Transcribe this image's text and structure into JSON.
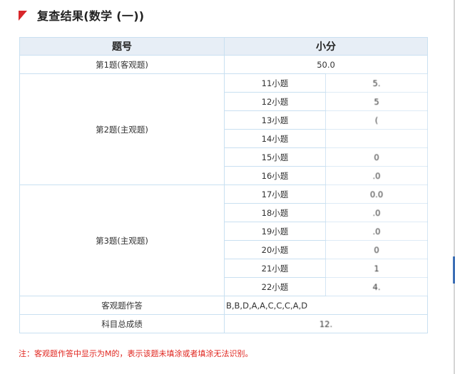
{
  "page": {
    "title": "复查结果(数学 (一))",
    "note": "注：客观题作答中显示为M的，表示该题未填涂或者填涂无法识别。"
  },
  "table": {
    "headers": [
      "题号",
      "小分"
    ],
    "q1": {
      "label": "第1题(客观题)",
      "value": "50.0"
    },
    "q2": {
      "label": "第2题(主观题)",
      "items": [
        {
          "sub": "11小题",
          "score": "5."
        },
        {
          "sub": "12小题",
          "score": "5"
        },
        {
          "sub": "13小题",
          "score": "("
        },
        {
          "sub": "14小题",
          "score": ""
        },
        {
          "sub": "15小题",
          "score": "0"
        },
        {
          "sub": "16小题",
          "score": ".0"
        }
      ]
    },
    "q3": {
      "label": "第3题(主观题)",
      "items": [
        {
          "sub": "17小题",
          "score": "0.0"
        },
        {
          "sub": "18小题",
          "score": ".0"
        },
        {
          "sub": "19小题",
          "score": ".0"
        },
        {
          "sub": "20小题",
          "score": "0"
        },
        {
          "sub": "21小题",
          "score": "1"
        },
        {
          "sub": "22小题",
          "score": "4."
        }
      ]
    },
    "objective_answer": {
      "label": "客观题作答",
      "value": "B,B,D,A,A,C,C,C,A,D"
    },
    "total": {
      "label": "科目总成绩",
      "value": "12."
    }
  },
  "colors": {
    "accent": "#d8262a",
    "header_bg": "#e7eef6",
    "border": "#c9e0f1",
    "note": "#e0261f"
  }
}
